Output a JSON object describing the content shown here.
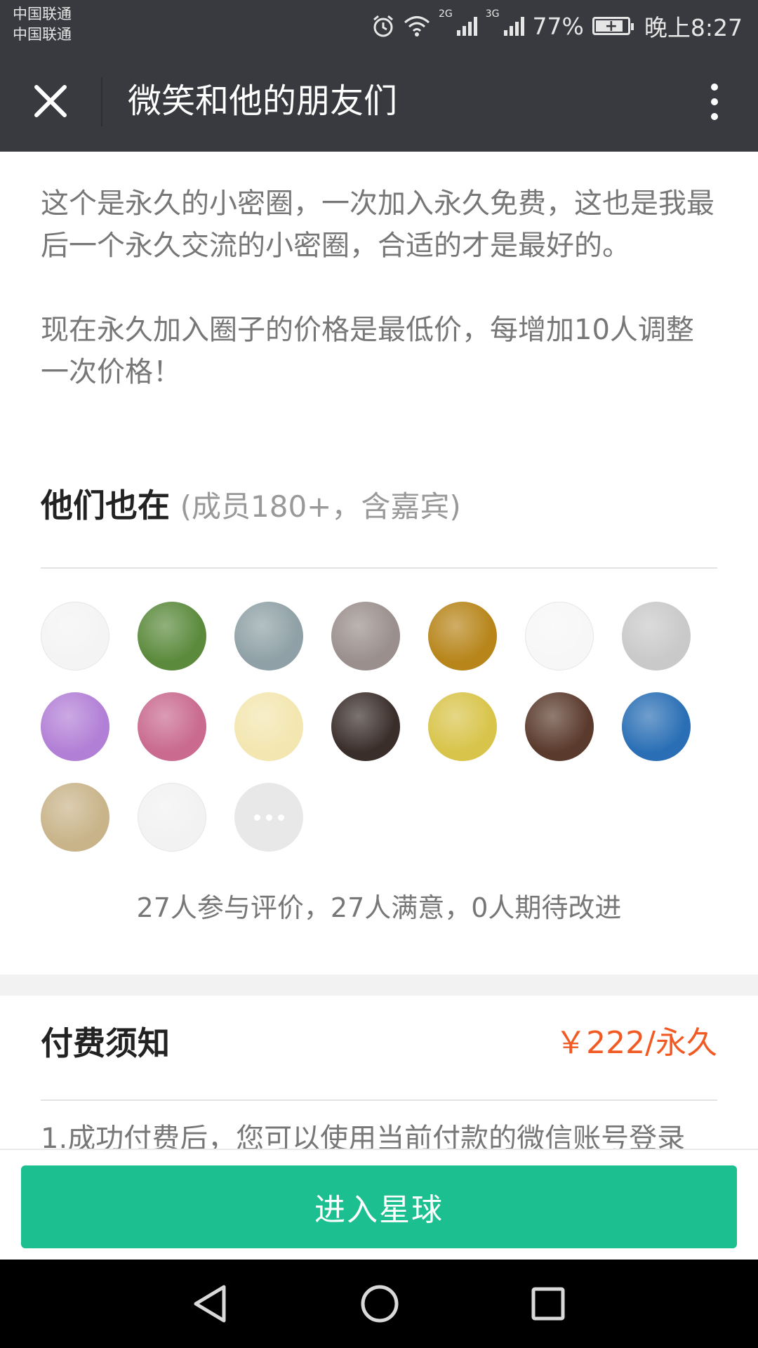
{
  "status_bar": {
    "carrier1": "中国联通",
    "carrier2": "中国联通",
    "net1": "2G",
    "net2": "3G",
    "battery": "77%",
    "time": "晚上8:27",
    "icons": [
      "alarm-icon",
      "wifi-icon",
      "signal-icon",
      "battery-icon"
    ]
  },
  "app_bar": {
    "title": "微笑和他的朋友们",
    "icons": [
      "close-icon",
      "more-vertical-icon"
    ]
  },
  "intro": {
    "paragraph1": "这个是永久的小密圈，一次加入永久免费，这也是我最后一个永久交流的小密圈，合适的才是最好的。",
    "paragraph2": "现在永久加入圈子的价格是最低价，每增加10人调整一次价格！"
  },
  "members": {
    "title": "他们也在",
    "subtitle": "(成员180+，含嘉宾)",
    "avatars": [
      {
        "name": "avatar-meme-face",
        "color": "#f4f4f4"
      },
      {
        "name": "avatar-man-outdoor",
        "color": "#5b8a3c"
      },
      {
        "name": "avatar-boy-soldier",
        "color": "#8fa1a6"
      },
      {
        "name": "avatar-sphynx-cat",
        "color": "#9a8f8c"
      },
      {
        "name": "avatar-golden-buddha",
        "color": "#b7851a"
      },
      {
        "name": "avatar-panda",
        "color": "#f7f7f7"
      },
      {
        "name": "avatar-manga",
        "color": "#c9c9c9"
      },
      {
        "name": "avatar-purple-pixel",
        "color": "#b27fd6"
      },
      {
        "name": "avatar-flowers",
        "color": "#c96a8e"
      },
      {
        "name": "avatar-cartoon-sheep",
        "color": "#f3e6b0"
      },
      {
        "name": "avatar-couple-selfie",
        "color": "#3a2e2a"
      },
      {
        "name": "avatar-cartoon-boy",
        "color": "#d8c44a"
      },
      {
        "name": "avatar-stage-men",
        "color": "#5a3a2c"
      },
      {
        "name": "avatar-minion",
        "color": "#2a6fb5"
      },
      {
        "name": "avatar-glasses-man",
        "color": "#c9b48a"
      },
      {
        "name": "avatar-pig-heart",
        "color": "#f2f2f2"
      }
    ],
    "more_icon": "more-horizontal-icon"
  },
  "rating_text": "27人参与评价，27人满意，0人期待改进",
  "fee": {
    "title": "付费须知",
    "price": "￥222/永久",
    "price_color": "#f15a22",
    "line1": "1.成功付费后，您可以使用当前付款的微信账号登录"
  },
  "action": {
    "enter_label": "进入星球",
    "color": "#1cbf8f"
  },
  "nav": {
    "icons": [
      "back-triangle-icon",
      "home-circle-icon",
      "recents-square-icon"
    ]
  }
}
